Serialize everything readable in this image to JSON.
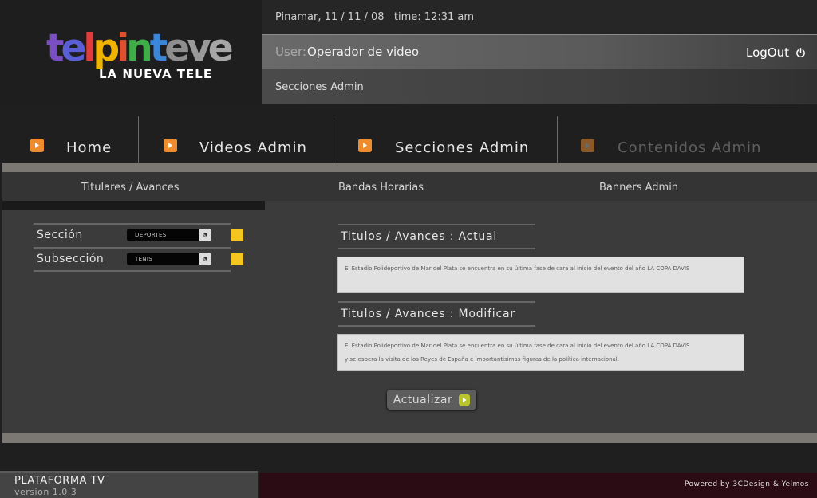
{
  "logo": {
    "letters": [
      {
        "ch": "t",
        "color": "#7a4fc4"
      },
      {
        "ch": "e",
        "color": "#5b5fd6"
      },
      {
        "ch": "l",
        "color": "#e13b3b"
      },
      {
        "ch": "p",
        "color": "#f0b400"
      },
      {
        "ch": "i",
        "color": "#e04f2f"
      },
      {
        "ch": "n",
        "color": "#3fae49"
      },
      {
        "ch": "t",
        "color": "#3a86d8"
      },
      {
        "ch": "e",
        "color": "#8e8e8e"
      },
      {
        "ch": "v",
        "color": "#9a9a9a"
      },
      {
        "ch": "e",
        "color": "#a6a6a6"
      }
    ],
    "tagline": "LA NUEVA TELE"
  },
  "header": {
    "info": "Pinamar, 11 / 11 / 08   time: 12:31 am",
    "user_label": "User:",
    "user_value": "Operador de video",
    "logout_label": "LogOut",
    "section": "Secciones Admin"
  },
  "nav": {
    "home": "Home",
    "videos": "Videos Admin",
    "secciones": "Secciones Admin",
    "contenidos": "Contenidos Admin"
  },
  "subtabs": {
    "titulares": "Titulares / Avances",
    "bandas": "Bandas Horarias",
    "banners": "Banners Admin"
  },
  "form": {
    "seccion_label": "Sección",
    "seccion_value": "DEPORTES",
    "subseccion_label": "Subsección",
    "subseccion_value": "TENIS",
    "swatch_color": "#f4c61f"
  },
  "actual": {
    "title": "Titulos / Avances : Actual",
    "text": "El Estadio Polideportivo de Mar del Plata se encuentra en su última fase de cara al inicio del evento del año LA COPA DAVIS"
  },
  "modificar": {
    "title": "Titulos / Avances : Modificar",
    "line1": "El Estadio Polideportivo de Mar del Plata se encuentra en su última fase de cara al inicio del evento del año LA COPA DAVIS",
    "line2": "y se espera la visita de los Reyes de España e importantisimas figuras de la política internacional."
  },
  "update_button": "Actualizar",
  "footer": {
    "platform": "PLATAFORMA TV",
    "version": "version 1.0.3",
    "powered": "Powered by 3CDesign & Yelmos"
  },
  "colors": {
    "nav_accent": "#ef8c2d",
    "update_accent": "#b9c52a"
  }
}
